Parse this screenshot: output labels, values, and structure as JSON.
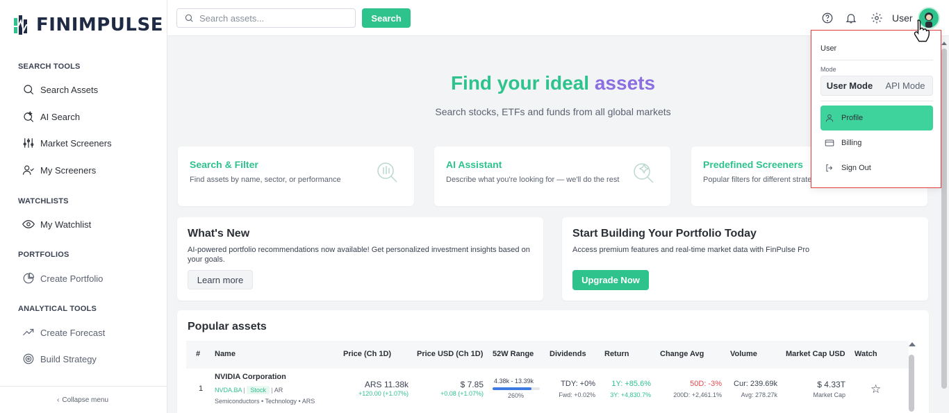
{
  "brand": {
    "name": "FINIMPULSE"
  },
  "sidebar": {
    "sections": [
      {
        "title": "SEARCH TOOLS"
      },
      {
        "title": "WATCHLISTS"
      },
      {
        "title": "PORTFOLIOS"
      },
      {
        "title": "ANALYTICAL TOOLS"
      }
    ],
    "items": [
      {
        "label": "Search Assets",
        "icon": "search-icon"
      },
      {
        "label": "AI Search",
        "icon": "ai-search-icon"
      },
      {
        "label": "Market Screeners",
        "icon": "sliders-icon"
      },
      {
        "label": "My Screeners",
        "icon": "user-check-icon"
      },
      {
        "label": "My Watchlist",
        "icon": "eye-icon"
      },
      {
        "label": "Create Portfolio",
        "icon": "pie-chart-icon"
      },
      {
        "label": "Create Forecast",
        "icon": "trend-up-icon"
      },
      {
        "label": "Build Strategy",
        "icon": "target-icon"
      }
    ],
    "collapse_label": "Collapse menu"
  },
  "topbar": {
    "search_placeholder": "Search assets...",
    "search_button": "Search",
    "user_label": "User"
  },
  "hero": {
    "title_part1": "Find your ideal",
    "title_part2": "assets",
    "subtitle": "Search stocks, ETFs and funds from all global markets"
  },
  "features": [
    {
      "title": "Search & Filter",
      "desc": "Find assets by name, sector, or performance"
    },
    {
      "title": "AI Assistant",
      "desc": "Describe what you're looking for — we'll do the rest"
    },
    {
      "title": "Predefined Screeners",
      "desc": "Popular filters for different strategies"
    }
  ],
  "whats_new": {
    "title": "What's New",
    "desc": "AI-powered portfolio recommendations now available! Get personalized investment insights based on your goals.",
    "button": "Learn more"
  },
  "portfolio_promo": {
    "title": "Start Building Your Portfolio Today",
    "desc": "Access premium features and real-time market data with FinPulse Pro",
    "button": "Upgrade Now"
  },
  "popular": {
    "title": "Popular assets",
    "columns": [
      "#",
      "Name",
      "Price (Ch 1D)",
      "Price USD (Ch 1D)",
      "52W Range",
      "Dividends",
      "Return",
      "Change Avg",
      "Volume",
      "Market Cap USD",
      "Watch"
    ],
    "rows": [
      {
        "rank": "1",
        "name": "NVIDIA Corporation",
        "ticker": "NVDA.BA",
        "type": "Stock",
        "country": "AR",
        "sector": "Semiconductors • Technology • ARS",
        "price": "ARS 11.38k",
        "price_change": "+120.00 (+1.07%)",
        "price_usd": "$ 7.85",
        "price_usd_change": "+0.08 (+1.07%)",
        "range": "4.38k - 13.39k",
        "range_pct": "260%",
        "range_fill": 0.82,
        "div_ttm": "TDY: +0%",
        "div_fwd": "Fwd: +0.02%",
        "ret_1y": "1Y: +85.6%",
        "ret_3y": "3Y: +4,830.7%",
        "chg_50d": "50D: -3%",
        "chg_200d": "200D: +2,461.1%",
        "vol_cur": "Cur: 239.69k",
        "vol_avg": "Avg: 278.27k",
        "mcap": "$ 4.33T",
        "mcap_label": "Market Cap"
      }
    ]
  },
  "user_menu": {
    "user": "User",
    "mode_label": "Mode",
    "modes": [
      "User Mode",
      "API Mode"
    ],
    "items": [
      {
        "label": "Profile",
        "icon": "user-icon"
      },
      {
        "label": "Billing",
        "icon": "credit-card-icon"
      },
      {
        "label": "Sign Out",
        "icon": "sign-out-icon"
      }
    ]
  },
  "colors": {
    "accent": "#2ec28d",
    "purple": "#8b6fe0",
    "highlight": "#3ed39d",
    "danger": "#e5484d"
  }
}
